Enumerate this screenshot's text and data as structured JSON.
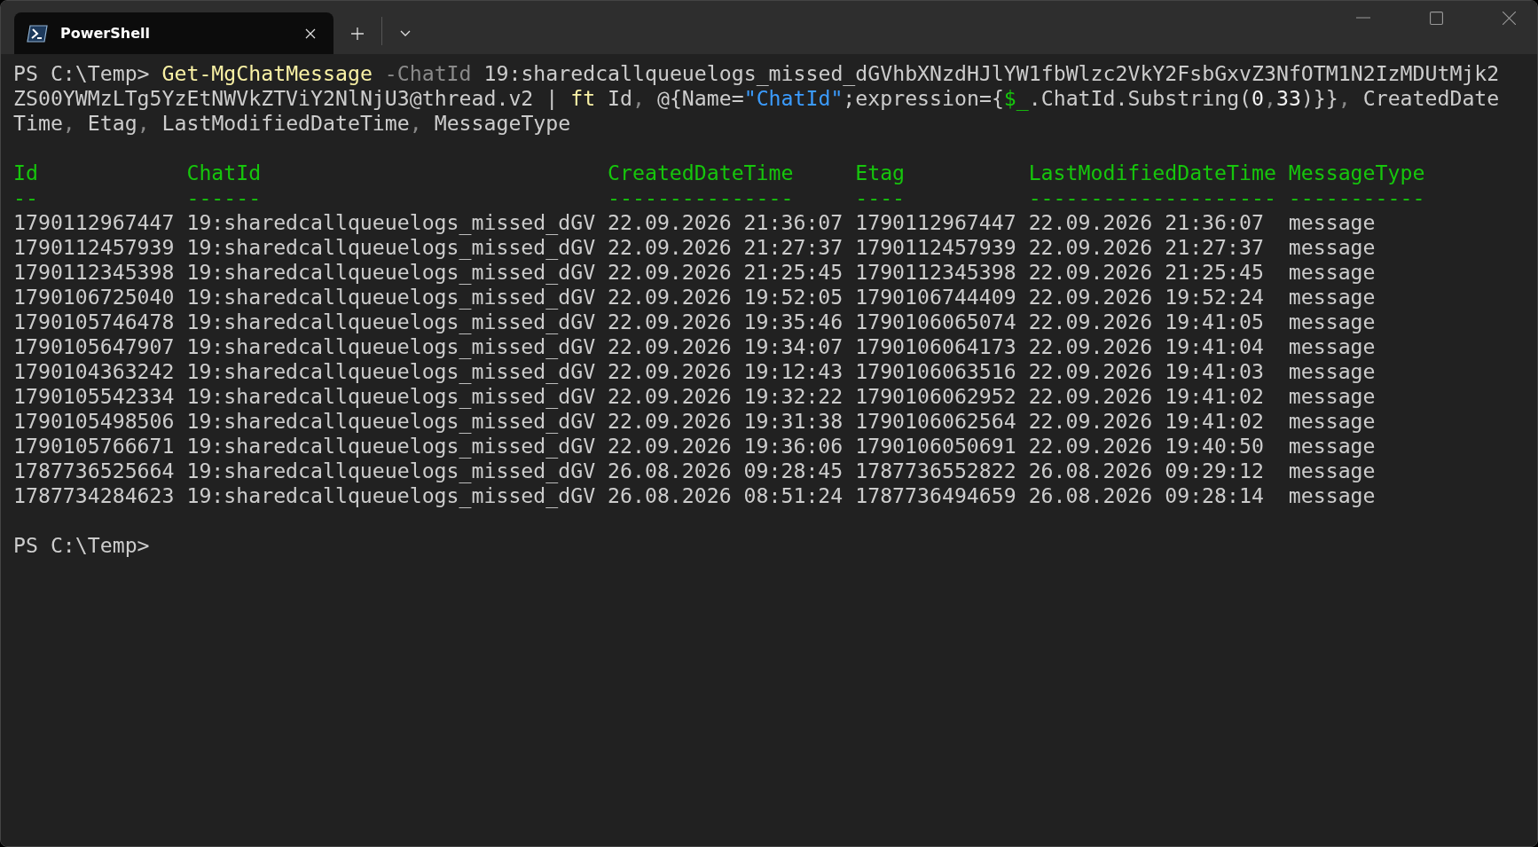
{
  "tabs": [
    {
      "title": "PowerShell",
      "selected": true
    }
  ],
  "command": [
    {
      "kind": "prompt",
      "text": "PS C:\\Temp> "
    },
    {
      "kind": "cmdlet",
      "text": "Get-MgChatMessage"
    },
    {
      "kind": "parameter",
      "text": " -ChatId"
    },
    {
      "kind": "plain",
      "text": " 19:sharedcallqueuelogs_missed_dGVhbXNzdHJlYW1fbWlzc2VkY2FsbGxvZ3NfOTM1N2IzMDUtMjk2ZS00YWMzLTg5YzEtNWVkZTViY2NlNjU3@thread.v2 | "
    },
    {
      "kind": "cmdlet",
      "text": "ft"
    },
    {
      "kind": "plain",
      "text": " Id"
    },
    {
      "kind": "operator",
      "text": ","
    },
    {
      "kind": "plain",
      "text": " @{Name="
    },
    {
      "kind": "string",
      "text": "\"ChatId\""
    },
    {
      "kind": "plain",
      "text": ";expression={"
    },
    {
      "kind": "variable",
      "text": "$_"
    },
    {
      "kind": "plain",
      "text": ".ChatId.Substring("
    },
    {
      "kind": "number",
      "text": "0"
    },
    {
      "kind": "operator",
      "text": ","
    },
    {
      "kind": "number",
      "text": "33"
    },
    {
      "kind": "plain",
      "text": ")}}"
    },
    {
      "kind": "operator",
      "text": ","
    },
    {
      "kind": "plain",
      "text": " CreatedDateTime"
    },
    {
      "kind": "operator",
      "text": ","
    },
    {
      "kind": "plain",
      "text": " Etag"
    },
    {
      "kind": "operator",
      "text": ","
    },
    {
      "kind": "plain",
      "text": " LastModifiedDateTime"
    },
    {
      "kind": "operator",
      "text": ","
    },
    {
      "kind": "plain",
      "text": " MessageType"
    }
  ],
  "table": {
    "columns": [
      {
        "name": "Id",
        "rule": "--"
      },
      {
        "name": "ChatId",
        "rule": "------"
      },
      {
        "name": "CreatedDateTime",
        "rule": "---------------"
      },
      {
        "name": "Etag",
        "rule": "----"
      },
      {
        "name": "LastModifiedDateTime",
        "rule": "--------------------"
      },
      {
        "name": "MessageType",
        "rule": "-----------"
      }
    ],
    "rows": [
      [
        "1790112967447",
        "19:sharedcallqueuelogs_missed_dGV",
        "22.09.2026 21:36:07",
        "1790112967447",
        "22.09.2026 21:36:07",
        "message"
      ],
      [
        "1790112457939",
        "19:sharedcallqueuelogs_missed_dGV",
        "22.09.2026 21:27:37",
        "1790112457939",
        "22.09.2026 21:27:37",
        "message"
      ],
      [
        "1790112345398",
        "19:sharedcallqueuelogs_missed_dGV",
        "22.09.2026 21:25:45",
        "1790112345398",
        "22.09.2026 21:25:45",
        "message"
      ],
      [
        "1790106725040",
        "19:sharedcallqueuelogs_missed_dGV",
        "22.09.2026 19:52:05",
        "1790106744409",
        "22.09.2026 19:52:24",
        "message"
      ],
      [
        "1790105746478",
        "19:sharedcallqueuelogs_missed_dGV",
        "22.09.2026 19:35:46",
        "1790106065074",
        "22.09.2026 19:41:05",
        "message"
      ],
      [
        "1790105647907",
        "19:sharedcallqueuelogs_missed_dGV",
        "22.09.2026 19:34:07",
        "1790106064173",
        "22.09.2026 19:41:04",
        "message"
      ],
      [
        "1790104363242",
        "19:sharedcallqueuelogs_missed_dGV",
        "22.09.2026 19:12:43",
        "1790106063516",
        "22.09.2026 19:41:03",
        "message"
      ],
      [
        "1790105542334",
        "19:sharedcallqueuelogs_missed_dGV",
        "22.09.2026 19:32:22",
        "1790106062952",
        "22.09.2026 19:41:02",
        "message"
      ],
      [
        "1790105498506",
        "19:sharedcallqueuelogs_missed_dGV",
        "22.09.2026 19:31:38",
        "1790106062564",
        "22.09.2026 19:41:02",
        "message"
      ],
      [
        "1790105766671",
        "19:sharedcallqueuelogs_missed_dGV",
        "22.09.2026 19:36:06",
        "1790106050691",
        "22.09.2026 19:40:50",
        "message"
      ],
      [
        "1787736525664",
        "19:sharedcallqueuelogs_missed_dGV",
        "26.08.2026 09:28:45",
        "1787736552822",
        "26.08.2026 09:29:12",
        "message"
      ],
      [
        "1787734284623",
        "19:sharedcallqueuelogs_missed_dGV",
        "26.08.2026 08:51:24",
        "1787736494659",
        "26.08.2026 09:28:14",
        "message"
      ]
    ]
  },
  "prompt": "PS C:\\Temp>"
}
